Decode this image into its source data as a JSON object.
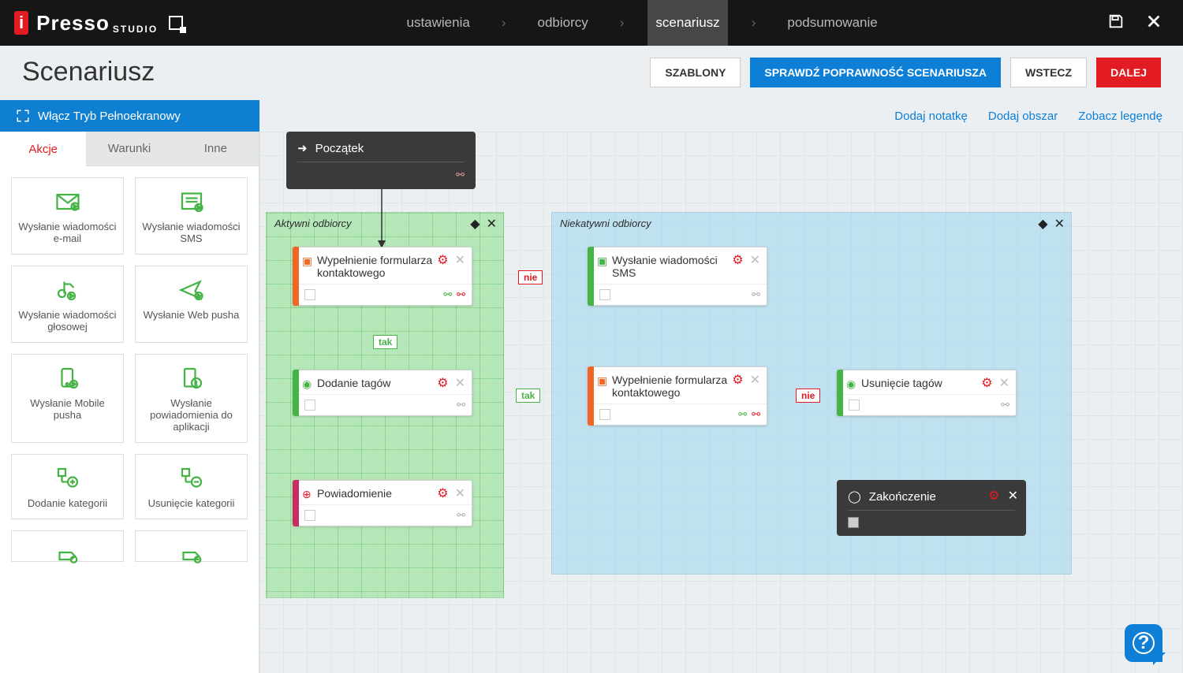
{
  "logo": {
    "brand_prefix": "i",
    "brand": "Presso",
    "sub": "STUDIO"
  },
  "breadcrumbs": {
    "items": [
      "ustawienia",
      "odbiorcy",
      "scenariusz",
      "podsumowanie"
    ],
    "activeIndex": 2
  },
  "page": {
    "title": "Scenariusz"
  },
  "buttons": {
    "templates": "SZABLONY",
    "validate": "SPRAWDŹ POPRAWNOŚĆ SCENARIUSZA",
    "back": "WSTECZ",
    "next": "DALEJ"
  },
  "fullscreen": "Włącz Tryb Pełnoekranowy",
  "toolbar_links": {
    "note": "Dodaj notatkę",
    "area": "Dodaj obszar",
    "legend": "Zobacz legendę"
  },
  "tabs": {
    "actions": "Akcje",
    "conditions": "Warunki",
    "other": "Inne"
  },
  "palette": [
    {
      "label": "Wysłanie wiadomości e-mail"
    },
    {
      "label": "Wysłanie wiadomości SMS"
    },
    {
      "label": "Wysłanie wiadomości głosowej"
    },
    {
      "label": "Wysłanie Web pusha"
    },
    {
      "label": "Wysłanie Mobile pusha"
    },
    {
      "label": "Wysłanie powiadomienia do aplikacji"
    },
    {
      "label": "Dodanie kategorii"
    },
    {
      "label": "Usunięcie kategorii"
    }
  ],
  "areas": {
    "green": {
      "title": "Aktywni odbiorcy"
    },
    "blue": {
      "title": "Niekatywni odbiorcy"
    }
  },
  "nodes": {
    "start": "Początek",
    "form1": "Wypełnienie formularza kontaktowego",
    "sms": "Wysłanie wiadomości SMS",
    "addtags": "Dodanie tagów",
    "form2": "Wypełnienie formularza kontaktowego",
    "removetags": "Usunięcie tagów",
    "notify": "Powiadomienie",
    "end": "Zakończenie"
  },
  "edgelabels": {
    "yes": "tak",
    "no": "nie"
  }
}
